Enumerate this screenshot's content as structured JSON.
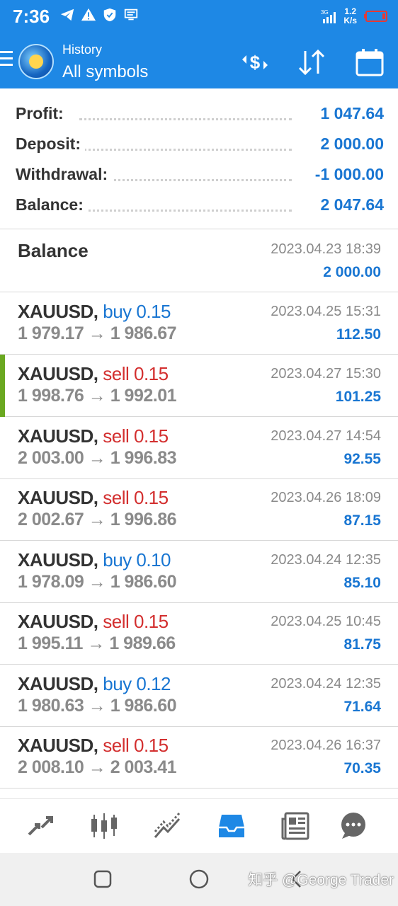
{
  "status_bar": {
    "time": "7:36",
    "net_speed_value": "1.2",
    "net_speed_unit": "K/s",
    "signal_label": "3G"
  },
  "header": {
    "subtitle": "History",
    "title": "All symbols",
    "icons": [
      "menu-icon",
      "app-logo",
      "currency-exchange-icon",
      "sort-icon",
      "calendar-icon"
    ]
  },
  "summary": {
    "profit_label": "Profit:",
    "profit_value": "1 047.64",
    "deposit_label": "Deposit:",
    "deposit_value": "2 000.00",
    "withdrawal_label": "Withdrawal:",
    "withdrawal_value": "-1 000.00",
    "balance_label": "Balance:",
    "balance_value": "2 047.64"
  },
  "balance_operation": {
    "title": "Balance",
    "date": "2023.04.23 18:39",
    "amount": "2 000.00"
  },
  "deals": [
    {
      "symbol": "XAUUSD,",
      "type": "buy 0.15",
      "side": "buy",
      "prices": "1 979.17 → 1 986.67",
      "date": "2023.04.25 15:31",
      "profit": "112.50"
    },
    {
      "symbol": "XAUUSD,",
      "type": "sell 0.15",
      "side": "sell",
      "prices": "1 998.76 → 1 992.01",
      "date": "2023.04.27 15:30",
      "profit": "101.25"
    },
    {
      "symbol": "XAUUSD,",
      "type": "sell 0.15",
      "side": "sell",
      "prices": "2 003.00 → 1 996.83",
      "date": "2023.04.27 14:54",
      "profit": "92.55"
    },
    {
      "symbol": "XAUUSD,",
      "type": "sell 0.15",
      "side": "sell",
      "prices": "2 002.67 → 1 996.86",
      "date": "2023.04.26 18:09",
      "profit": "87.15"
    },
    {
      "symbol": "XAUUSD,",
      "type": "buy 0.10",
      "side": "buy",
      "prices": "1 978.09 → 1 986.60",
      "date": "2023.04.24 12:35",
      "profit": "85.10"
    },
    {
      "symbol": "XAUUSD,",
      "type": "sell 0.15",
      "side": "sell",
      "prices": "1 995.11 → 1 989.66",
      "date": "2023.04.25 10:45",
      "profit": "81.75"
    },
    {
      "symbol": "XAUUSD,",
      "type": "buy 0.12",
      "side": "buy",
      "prices": "1 980.63 → 1 986.60",
      "date": "2023.04.24 12:35",
      "profit": "71.64"
    },
    {
      "symbol": "XAUUSD,",
      "type": "sell 0.15",
      "side": "sell",
      "prices": "2 008.10 → 2 003.41",
      "date": "2023.04.26 16:37",
      "profit": "70.35"
    }
  ],
  "bottom_nav": [
    "quotes-icon",
    "chart-icon",
    "trade-icon",
    "history-icon",
    "news-icon",
    "chat-icon"
  ],
  "active_tab": "history-icon",
  "system_nav": [
    "recents-icon",
    "home-icon",
    "back-icon"
  ],
  "watermark": "知乎 @George Trader",
  "colors": {
    "primary": "#1e88e5",
    "buy": "#1976d2",
    "sell": "#d32f2f",
    "highlight": "#6aa820"
  }
}
